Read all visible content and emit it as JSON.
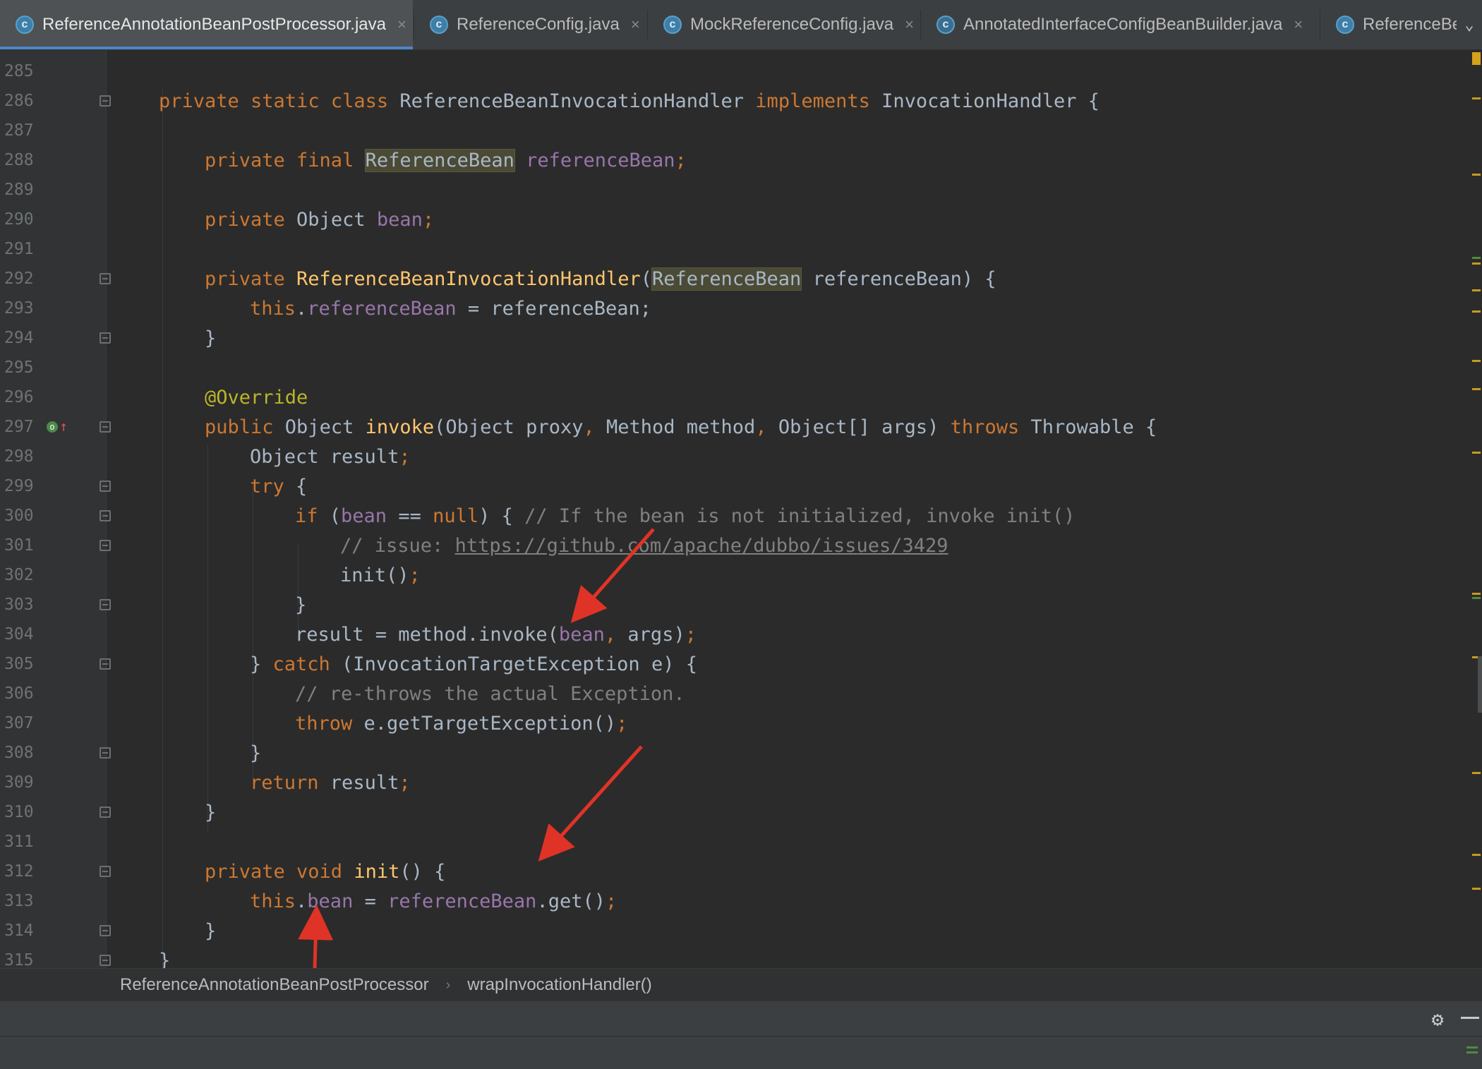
{
  "tabs": [
    {
      "label": "ReferenceAnnotationBeanPostProcessor.java",
      "icon": "class-icon",
      "icon_glyph": "c",
      "active": true
    },
    {
      "label": "ReferenceConfig.java",
      "icon": "class-icon",
      "icon_glyph": "c",
      "active": false
    },
    {
      "label": "MockReferenceConfig.java",
      "icon": "class-icon",
      "icon_glyph": "c",
      "active": false
    },
    {
      "label": "AnnotatedInterfaceConfigBeanBuilder.java",
      "icon": "abstract-class-icon",
      "icon_glyph": "c",
      "active": false
    },
    {
      "label": "ReferenceBea",
      "icon": "class-icon",
      "icon_glyph": "c",
      "active": false
    }
  ],
  "tab_close_glyph": "×",
  "tab_overflow_glyph": "⌄",
  "editor": {
    "line_numbers": [
      "285",
      "286",
      "287",
      "288",
      "289",
      "290",
      "291",
      "292",
      "293",
      "294",
      "295",
      "296",
      "297",
      "298",
      "299",
      "300",
      "301",
      "302",
      "303",
      "304",
      "305",
      "306",
      "307",
      "308",
      "309",
      "310",
      "311",
      "312",
      "313",
      "314",
      "315"
    ],
    "code": {
      "l285": "",
      "l286": {
        "kw1": "private static class ",
        "name": "ReferenceBeanInvocationHandler",
        "kw2": " implements ",
        "iface": "InvocationHandler",
        "rest": " {"
      },
      "l288": {
        "kw": "private final ",
        "type": "ReferenceBean",
        "fld": " referenceBean",
        "rest": ";"
      },
      "l290": {
        "kw": "private ",
        "type": "Object ",
        "fld": "bean",
        "rest": ";"
      },
      "l292": {
        "kw": "private ",
        "fn": "ReferenceBeanInvocationHandler",
        "p1": "(",
        "type": "ReferenceBean",
        "rest": " referenceBean) {"
      },
      "l293": {
        "kw": "this",
        "dot": ".",
        "fld": "referenceBean",
        "rest": " = referenceBean;"
      },
      "l294": "}",
      "l296": "@Override",
      "l297": {
        "kw": "public ",
        "type": "Object ",
        "fn": "invoke",
        "rest1": "(Object proxy",
        "c1": ", ",
        "rest2": "Method method",
        "c2": ", ",
        "rest3": "Object[] args) ",
        "kw2": "throws",
        "rest4": " Throwable {"
      },
      "l298": {
        "text": "Object result",
        "semi": ";"
      },
      "l299": {
        "kw": "try",
        "rest": " {"
      },
      "l300": {
        "kw": "if",
        "p": " (",
        "fld": "bean",
        "op": " == ",
        "kw2": "null",
        "rest": ") { ",
        "cmt": "// If the bean is not initialized, invoke init()"
      },
      "l301": {
        "cmt": "// issue: ",
        "link": "https://github.com/apache/dubbo/issues/3429"
      },
      "l302": {
        "text": "init()",
        "semi": ";"
      },
      "l303": "}",
      "l304": {
        "text": "result = method.invoke(",
        "fld": "bean",
        "c": ", ",
        "rest": "args)",
        "semi": ";"
      },
      "l305": {
        "p": "} ",
        "kw": "catch",
        "rest": " (InvocationTargetException e) {"
      },
      "l306": "// re-throws the actual Exception.",
      "l307": {
        "kw": "throw",
        "rest": " e.getTargetException()",
        "semi": ";"
      },
      "l308": "}",
      "l309": {
        "kw": "return",
        "rest": " result",
        "semi": ";"
      },
      "l310": "}",
      "l312": {
        "kw": "private void ",
        "fn": "init",
        "rest": "() {"
      },
      "l313": {
        "kw": "this",
        "dot": ".",
        "fld": "bean",
        "op": " = ",
        "fld2": "referenceBean",
        "rest": ".get()",
        "semi": ";"
      },
      "l314": "}",
      "l315": "}"
    }
  },
  "breadcrumb": {
    "items": [
      "ReferenceAnnotationBeanPostProcessor",
      "wrapInvocationHandler()"
    ],
    "separator": "›"
  },
  "bottom_bar": {
    "settings_icon": "gear-icon",
    "settings_glyph": "⚙",
    "hide_icon": "minus-icon"
  },
  "colors": {
    "keyword": "#cc7832",
    "method": "#ffc66d",
    "field": "#9876aa",
    "annotation": "#bbb529",
    "comment": "#808080",
    "annotation_arrow": "#e03327",
    "background": "#2b2b2b"
  }
}
